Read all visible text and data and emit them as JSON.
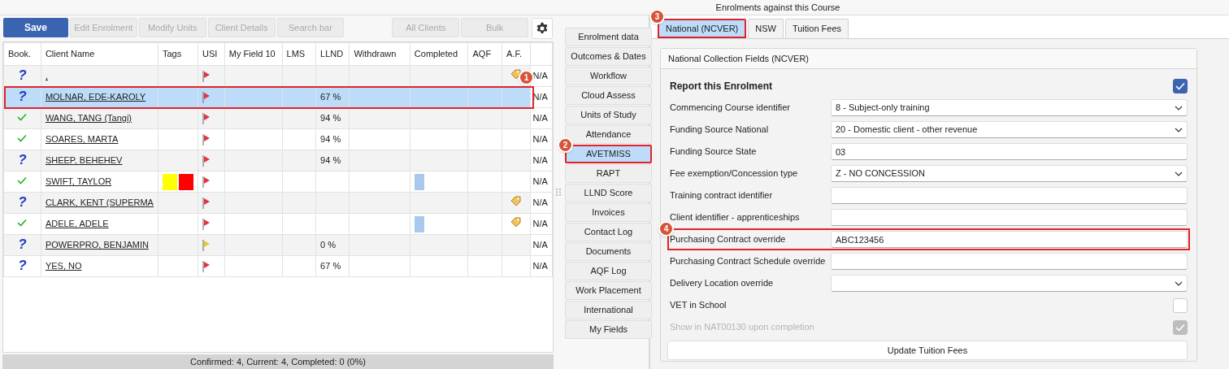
{
  "header": {
    "title": "Enrolments against this Course"
  },
  "toolbar": [
    {
      "label": "Save",
      "kind": "primary",
      "disabled": false
    },
    {
      "label": "Edit Enrolment",
      "kind": "button",
      "disabled": true
    },
    {
      "label": "Modify Units",
      "kind": "button",
      "disabled": true
    },
    {
      "label": "Client Details",
      "kind": "button",
      "disabled": true
    },
    {
      "label": "Search bar",
      "kind": "button",
      "disabled": true
    },
    {
      "kind": "spacer"
    },
    {
      "label": "All Clients",
      "kind": "button",
      "disabled": true
    },
    {
      "label": "Bulk",
      "kind": "button",
      "disabled": true
    },
    {
      "kind": "settings",
      "disabled": false
    }
  ],
  "table": {
    "columns": [
      "Book.",
      "Client Name",
      "Tags",
      "USI",
      "My Field 10",
      "LMS",
      "LLND",
      "Withdrawn",
      "Completed",
      "AQF",
      "A.F."
    ],
    "rows": [
      {
        "confirmed": false,
        "booking_text": "?",
        "name": ",",
        "tags": [],
        "usi_flag": {
          "color": "#e53340"
        },
        "llnd": "",
        "completed_mark": false,
        "af_tag": true,
        "column_12": "N/A",
        "selected": false
      },
      {
        "confirmed": false,
        "booking_text": "?",
        "name": "MOLNAR, EDE-KAROLY",
        "tags": [],
        "usi_flag": {
          "color": "#e53340"
        },
        "llnd": "67 %",
        "completed_mark": false,
        "af_tag": false,
        "column_12": "N/A",
        "selected": true,
        "callout": "1"
      },
      {
        "confirmed": true,
        "name": "WANG, TANG (Tangi)",
        "tags": [],
        "usi_flag": {
          "color": "#e53340"
        },
        "llnd": "94 %",
        "completed_mark": false,
        "af_tag": false,
        "column_12": "N/A",
        "selected": false
      },
      {
        "confirmed": true,
        "name": "SOARES, MARTA",
        "tags": [],
        "usi_flag": {
          "color": "#e53340"
        },
        "llnd": "94 %",
        "completed_mark": false,
        "af_tag": false,
        "column_12": "N/A",
        "selected": false
      },
      {
        "confirmed": false,
        "booking_text": "?",
        "name": "SHEEP, BEHEHEV",
        "tags": [],
        "usi_flag": {
          "color": "#e53340"
        },
        "llnd": "94 %",
        "completed_mark": false,
        "af_tag": false,
        "column_12": "N/A",
        "selected": false
      },
      {
        "confirmed": true,
        "name": "SWIFT, TAYLOR",
        "tags": [
          {
            "color": "#ffff00"
          },
          {
            "color": "#ff0000"
          }
        ],
        "usi_flag": {
          "color": "#e53340"
        },
        "llnd": "",
        "completed_mark": true,
        "af_tag": false,
        "column_12": "N/A",
        "selected": false
      },
      {
        "confirmed": false,
        "booking_text": "?",
        "name": "CLARK, KENT (SUPERMA",
        "tags": [],
        "usi_flag": {
          "color": "#e53340"
        },
        "llnd": "",
        "completed_mark": false,
        "af_tag": true,
        "column_12": "N/A",
        "selected": false
      },
      {
        "confirmed": true,
        "name": "ADELE, ADELE",
        "tags": [],
        "usi_flag": {
          "color": "#e53340"
        },
        "llnd": "",
        "completed_mark": true,
        "af_tag": true,
        "column_12": "N/A",
        "selected": false
      },
      {
        "confirmed": false,
        "booking_text": "?",
        "name": "POWERPRO, BENJAMIN",
        "tags": [],
        "usi_flag": {
          "color": "#e8c53a"
        },
        "llnd": "0 %",
        "completed_mark": false,
        "af_tag": false,
        "column_12": "N/A",
        "selected": false
      },
      {
        "confirmed": false,
        "booking_text": "?",
        "name": "YES, NO",
        "tags": [],
        "usi_flag": {
          "color": "#e53340"
        },
        "llnd": "67 %",
        "completed_mark": false,
        "af_tag": false,
        "column_12": "N/A",
        "selected": false
      }
    ]
  },
  "status_bar": "Confirmed: 4, Current: 4, Completed: 0 (0%)",
  "sections": [
    {
      "label": "Enrolment data",
      "selected": false
    },
    {
      "label": "Outcomes & Dates",
      "selected": false
    },
    {
      "label": "Workflow",
      "selected": false
    },
    {
      "label": "Cloud Assess",
      "selected": false
    },
    {
      "label": "Units of Study",
      "selected": false
    },
    {
      "label": "Attendance",
      "selected": false
    },
    {
      "label": "AVETMISS",
      "selected": true,
      "callout": "2"
    },
    {
      "label": "RAPT",
      "selected": false
    },
    {
      "label": "LLND Score",
      "selected": false
    },
    {
      "label": "Invoices",
      "selected": false
    },
    {
      "label": "Contact Log",
      "selected": false
    },
    {
      "label": "Documents",
      "selected": false
    },
    {
      "label": "AQF Log",
      "selected": false
    },
    {
      "label": "Work Placement",
      "selected": false
    },
    {
      "label": "International",
      "selected": false
    },
    {
      "label": "My Fields",
      "selected": false
    }
  ],
  "tabs": [
    {
      "label": "National (NCVER)",
      "selected": true,
      "callout": "3"
    },
    {
      "label": "NSW",
      "selected": false
    },
    {
      "label": "Tuition Fees",
      "selected": false
    }
  ],
  "panel": {
    "title": "National Collection Fields (NCVER)",
    "fields": [
      {
        "kind": "heading",
        "label": "Report this Enrolment",
        "checked": true
      },
      {
        "kind": "select",
        "label": "Commencing Course identifier",
        "value": "8 - Subject-only training"
      },
      {
        "kind": "select",
        "label": "Funding Source National",
        "value": "20 - Domestic client - other revenue"
      },
      {
        "kind": "text",
        "label": "Funding Source State",
        "value": "03"
      },
      {
        "kind": "select",
        "label": "Fee exemption/Concession type",
        "value": "Z - NO CONCESSION"
      },
      {
        "kind": "text",
        "label": "Training contract identifier"
      },
      {
        "kind": "text",
        "label": "Client identifier - apprenticeships"
      },
      {
        "kind": "text",
        "label": "Purchasing Contract override",
        "value": "ABC123456",
        "callout": "4"
      },
      {
        "kind": "text",
        "label": "Purchasing Contract Schedule override"
      },
      {
        "kind": "select",
        "label": "Delivery Location override"
      },
      {
        "kind": "checkbox",
        "label": "VET in School",
        "checked": false
      },
      {
        "kind": "checkbox",
        "label": "Show in NAT00130 upon completion",
        "checked": true,
        "disabled": true
      }
    ],
    "button": "Update Tuition Fees"
  }
}
